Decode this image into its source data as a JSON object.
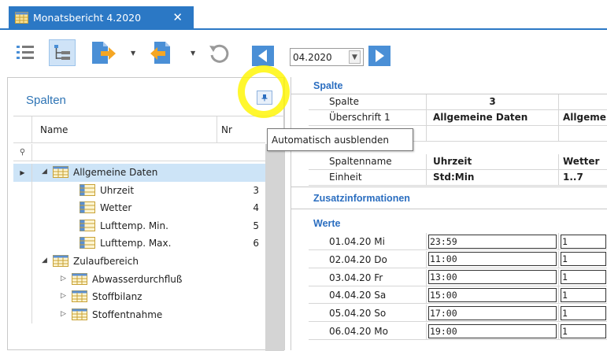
{
  "window": {
    "tab_title": "Monatsbericht 4.2020",
    "close_symbol": "✕"
  },
  "toolbar": {
    "period_value": "04.2020",
    "icons": [
      "list-view-icon",
      "tree-view-icon",
      "export-document-icon",
      "import-document-icon",
      "undo-icon",
      "previous-month-icon",
      "next-month-icon"
    ]
  },
  "left_panel": {
    "title": "Spalten",
    "columns": {
      "name": "Name",
      "nr": "Nr"
    },
    "tree": [
      {
        "label": "Allgemeine Daten",
        "nr": "",
        "level": 0,
        "expanded": true,
        "selected": true
      },
      {
        "label": "Uhrzeit",
        "nr": "3",
        "level": 1
      },
      {
        "label": "Wetter",
        "nr": "4",
        "level": 1
      },
      {
        "label": "Lufttemp. Min.",
        "nr": "5",
        "level": 1
      },
      {
        "label": "Lufttemp. Max.",
        "nr": "6",
        "level": 1
      },
      {
        "label": "Zulaufbereich",
        "nr": "",
        "level": 0,
        "expanded": true
      },
      {
        "label": "Abwasserdurchfluß",
        "nr": "",
        "level": 1,
        "collapsed": true
      },
      {
        "label": "Stoffbilanz",
        "nr": "",
        "level": 1,
        "collapsed": true
      },
      {
        "label": "Stoffentnahme",
        "nr": "",
        "level": 1,
        "collapsed": true
      }
    ]
  },
  "tooltip": {
    "text": "Automatisch ausblenden"
  },
  "right_panel": {
    "section_spalte": "Spalte",
    "props": {
      "spalte": {
        "key": "Spalte",
        "v1": "3",
        "v2": ""
      },
      "ueberschrift": {
        "key": "Überschrift 1",
        "v1": "Allgemeine Daten",
        "v2": "Allgeme"
      },
      "spaltenname": {
        "key": "Spaltenname",
        "v1": "Uhrzeit",
        "v2": "Wetter"
      },
      "einheit": {
        "key": "Einheit",
        "v1": "Std:Min",
        "v2": "1..7"
      }
    },
    "section_zusatz": "Zusatzinformationen",
    "section_werte": "Werte",
    "werte": [
      {
        "date": "01.04.20 Mi",
        "time": "23:59",
        "val": "1"
      },
      {
        "date": "02.04.20 Do",
        "time": "11:00",
        "val": "1"
      },
      {
        "date": "03.04.20 Fr",
        "time": "13:00",
        "val": "1"
      },
      {
        "date": "04.04.20 Sa",
        "time": "15:00",
        "val": "1"
      },
      {
        "date": "05.04.20 So",
        "time": "17:00",
        "val": "1"
      },
      {
        "date": "06.04.20 Mo",
        "time": "19:00",
        "val": "1"
      }
    ]
  },
  "colors": {
    "accent": "#2b78c5",
    "header_blue": "#2b6ec0",
    "selection": "#cde4f7",
    "highlight_yellow": "#fff500",
    "arrow_orange": "#f5a623",
    "nav_blue": "#4a8fd6"
  }
}
